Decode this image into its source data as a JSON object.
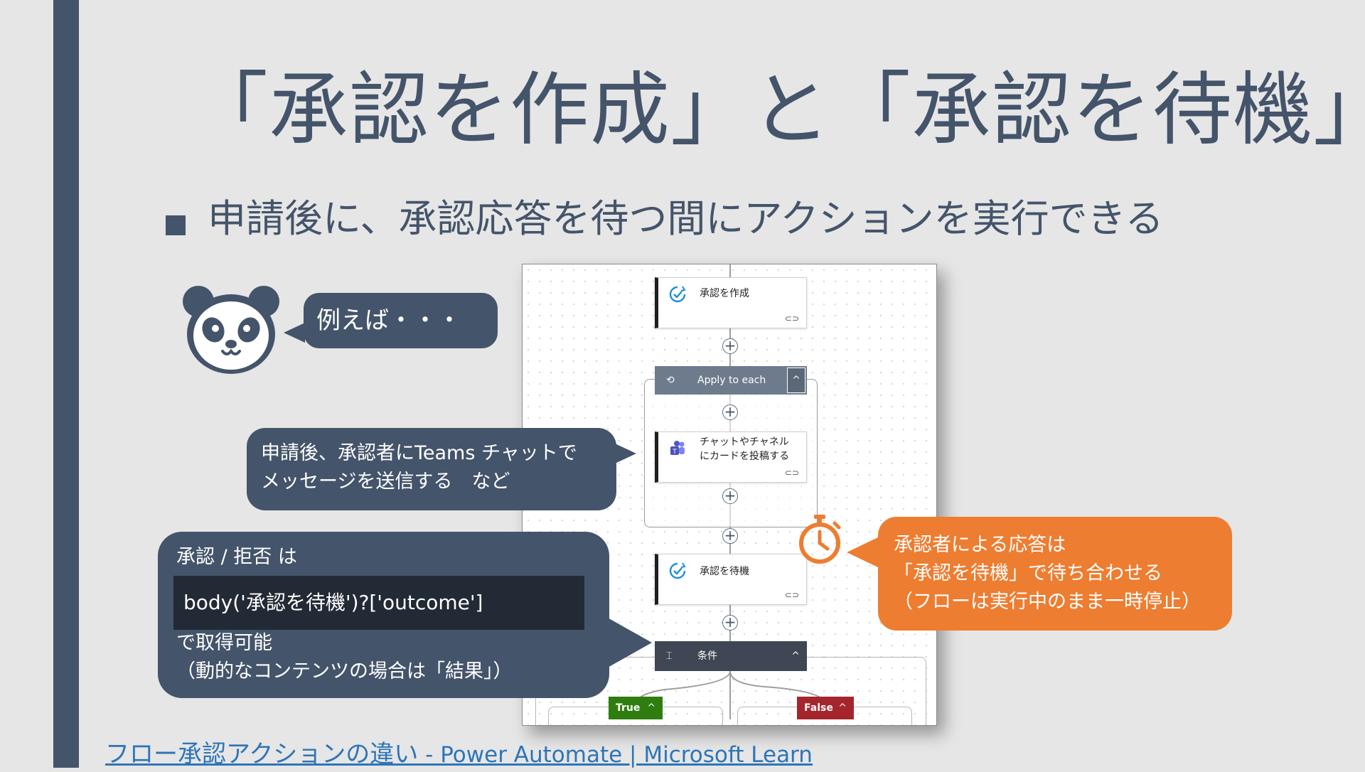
{
  "slide": {
    "title": "「承認を作成」と「承認を待機」",
    "subtitle": "申請後に、承認応答を待つ間にアクションを実行できる"
  },
  "bubbles": {
    "example": "例えば・・・",
    "teams_line1": "申請後、承認者にTeams チャットで",
    "teams_line2": "メッセージを送信する　など",
    "outcome_line1": "承認 / 拒否 は",
    "outcome_code": "body('承認を待機')?['outcome']",
    "outcome_line3": "で取得可能",
    "outcome_line4": "（動的なコンテンツの場合は「結果」）",
    "orange_line1": "承認者による応答は",
    "orange_line2": "「承認を待機」で待ち合わせる",
    "orange_line3": "（フローは実行中のまま一時停止）"
  },
  "flow": {
    "create_approval": "承認を作成",
    "apply_to_each": "Apply to each",
    "teams_post_line1": "チャットやチャネル",
    "teams_post_line2": "にカードを投稿する",
    "wait_approval": "承認を待機",
    "condition": "条件",
    "true_label": "True",
    "false_label": "False",
    "colors": {
      "true": "#2f7d0f",
      "false": "#a4262c",
      "header": "#6d7b8d",
      "condition": "#3e4753"
    }
  },
  "footer": {
    "link_main": "フロー承認アクションの違い",
    "link_rest": " - Power Automate | Microsoft Learn"
  },
  "theme": {
    "primary": "#44546a",
    "accent": "#ed7d31",
    "link": "#2e75b6",
    "background": "#e6e6e6"
  }
}
